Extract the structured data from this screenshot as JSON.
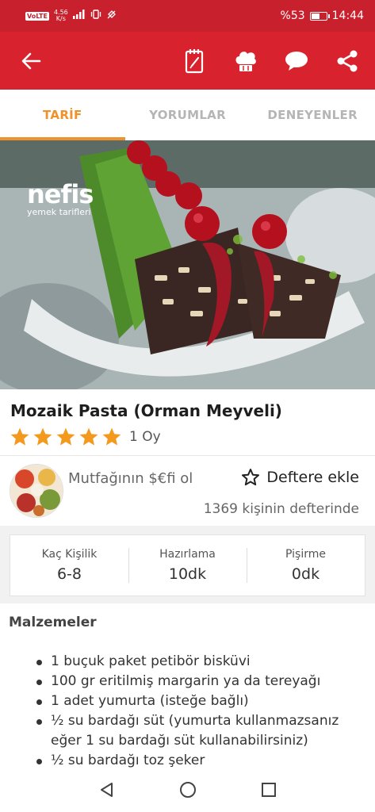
{
  "status_bar": {
    "volte": "VoLTE",
    "speed_value": "4.56",
    "speed_unit": "K/s",
    "battery_label": "%53",
    "battery_level": 0.53,
    "time": "14:44"
  },
  "app_bar": {
    "icons": [
      "back-arrow-icon",
      "notepad-icon",
      "chef-hat-icon",
      "chat-bubble-icon",
      "share-icon"
    ]
  },
  "tabs": [
    {
      "label": "TARİF",
      "active": true
    },
    {
      "label": "YORUMLAR",
      "active": false
    },
    {
      "label": "DENEYENLER",
      "active": false
    }
  ],
  "hero": {
    "watermark_brand": "nefis",
    "watermark_sub": "yemek tarifleri"
  },
  "recipe": {
    "title": "Mozaik Pasta (Orman Meyveli)",
    "rating": 5,
    "votes": "1 Oy"
  },
  "author": {
    "name": "Mutfağının $€fi ol",
    "add_to_notebook": "Deftere ekle",
    "notebook_count": "1369 kişinin defterinde"
  },
  "info": [
    {
      "label": "Kaç Kişilik",
      "value": "6-8"
    },
    {
      "label": "Hazırlama",
      "value": "10dk"
    },
    {
      "label": "Pişirme",
      "value": "0dk"
    }
  ],
  "ingredients": {
    "title": "Malzemeler",
    "items": [
      "1 buçuk paket petibör bisküvi",
      "100 gr eritilmiş margarin ya da tereyağı",
      "1 adet yumurta (isteğe bağlı)",
      "½ su bardağı süt (yumurta kullanmazsanız eğer 1 su bardağı süt kullanabilirsiniz)",
      "½ su bardağı toz şeker"
    ]
  },
  "colors": {
    "brand_red": "#d8232f",
    "status_red": "#c8202d",
    "tab_active": "#f0922b",
    "star": "#f39a1e"
  },
  "nav_bar": {
    "icons": [
      "back-triangle-icon",
      "home-circle-icon",
      "recents-square-icon"
    ]
  }
}
